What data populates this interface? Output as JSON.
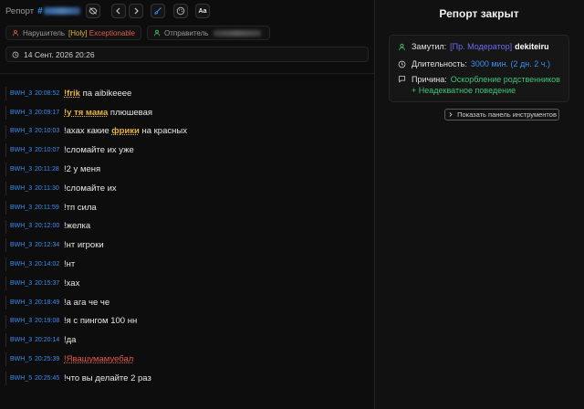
{
  "header": {
    "report_label": "Репорт",
    "hash": "#",
    "aa_label": "Aa"
  },
  "icons": {
    "eye_off": "eye-off-icon",
    "prev": "chevron-left-icon",
    "next": "chevron-right-icon",
    "brush": "brush-icon",
    "palette": "palette-icon",
    "user": "user-icon",
    "clock": "clock-icon",
    "message": "message-icon"
  },
  "chips": {
    "violator_label": "Нарушитель",
    "violator_tag": "[Holy]",
    "violator_name": "Exceptionable",
    "sender_label": "Отправитель"
  },
  "date": "14 Сент. 2026 20:26",
  "log": [
    {
      "user": "BWH_3",
      "time": "20:08:52",
      "pre": "",
      "hl": "!frik",
      "post": " па aibikeeee",
      "red": false
    },
    {
      "user": "BWH_3",
      "time": "20:09:17",
      "pre": "",
      "hl": "!у тя мама",
      "post": " плюшевая",
      "red": false
    },
    {
      "user": "BWH_3",
      "time": "20:10:03",
      "pre": "!ахах какие ",
      "hl": "фрики",
      "post": " на красных",
      "red": false
    },
    {
      "user": "BWH_3",
      "time": "20:10:07",
      "pre": "!сломайте их уже",
      "hl": "",
      "post": "",
      "red": false
    },
    {
      "user": "BWH_3",
      "time": "20:11:28",
      "pre": "!2 у меня",
      "hl": "",
      "post": "",
      "red": false
    },
    {
      "user": "BWH_3",
      "time": "20:11:30",
      "pre": "!сломайте их",
      "hl": "",
      "post": "",
      "red": false
    },
    {
      "user": "BWH_3",
      "time": "20:11:59",
      "pre": "!тп сила",
      "hl": "",
      "post": "",
      "red": false
    },
    {
      "user": "BWH_3",
      "time": "20:12:00",
      "pre": "!желка",
      "hl": "",
      "post": "",
      "red": false
    },
    {
      "user": "BWH_3",
      "time": "20:12:34",
      "pre": "!нт игроки",
      "hl": "",
      "post": "",
      "red": false
    },
    {
      "user": "BWH_3",
      "time": "20:14:02",
      "pre": "!нт",
      "hl": "",
      "post": "",
      "red": false
    },
    {
      "user": "BWH_3",
      "time": "20:15:37",
      "pre": "!хах",
      "hl": "",
      "post": "",
      "red": false
    },
    {
      "user": "BWH_3",
      "time": "20:18:49",
      "pre": "!а ага че че",
      "hl": "",
      "post": "",
      "red": false
    },
    {
      "user": "BWH_3",
      "time": "20:19:08",
      "pre": "!я с пингом 100 нн",
      "hl": "",
      "post": "",
      "red": false
    },
    {
      "user": "BWH_3",
      "time": "20:20:14",
      "pre": "!да",
      "hl": "",
      "post": "",
      "red": false
    },
    {
      "user": "BWH_5",
      "time": "20:25:39",
      "pre": "",
      "hl": "!Явашумамуебал",
      "post": "",
      "red": true
    },
    {
      "user": "BWH_5",
      "time": "20:25:45",
      "pre": "!что вы делайте 2 раз",
      "hl": "",
      "post": "",
      "red": false
    }
  ],
  "panel": {
    "title": "Репорт закрыт",
    "muted_label": "Замутил:",
    "muted_rank": "[Пр. Модератор]",
    "muted_name": "dekiteiru",
    "duration_label": "Длительность:",
    "duration_value": "3000 мин. (2 дн. 2 ч.)",
    "reason_label": "Причина:",
    "reason_value": "Оскорбление родственников + Неадекватное поведение",
    "tools_button": "Показать панель инструментов"
  },
  "colors": {
    "accent_blue": "#3a8df0",
    "highlight_yellow": "#e8b43b",
    "danger_red": "#e05a4a",
    "reason_green": "#3ec47a",
    "rank_purple": "#6a6cf0"
  }
}
